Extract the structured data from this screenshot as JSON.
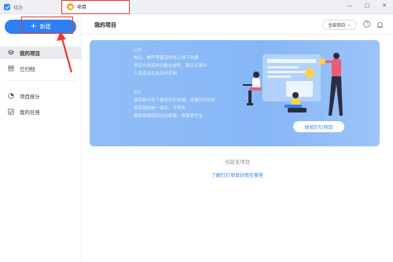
{
  "titlebar": {
    "tabs": [
      {
        "label": "待办"
      },
      {
        "label": "项目"
      }
    ]
  },
  "sidebar": {
    "new_button": "新建",
    "items": [
      {
        "label": "我的项目"
      },
      {
        "label": "已归档"
      },
      {
        "label": "项目统计"
      },
      {
        "label": "我的任务"
      }
    ]
  },
  "main": {
    "title": "我的项目",
    "filter": "全部项目",
    "banner": {
      "section1_head": "以前",
      "section1_lines": [
        "电话、邮件等繁杂的线上线下沟通",
        "项目文档资料分散在邮件、聊天记录中",
        "人员变动无法及时控制"
      ],
      "section2_head": "现在",
      "section2_lines": [
        "项目群中各个角色实时沟通，进展实时同步",
        "项目资料统一保存，不丢失",
        "离职即刻收回访问权限，数据更安全"
      ],
      "cta": "体验钉钉项目"
    },
    "empty_text": "当前无项目",
    "empty_link": "了解钉钉项目好用在哪里"
  },
  "colors": {
    "accent": "#2f7ff5",
    "banner": "#8fbef7",
    "annotation": "#e53935"
  }
}
